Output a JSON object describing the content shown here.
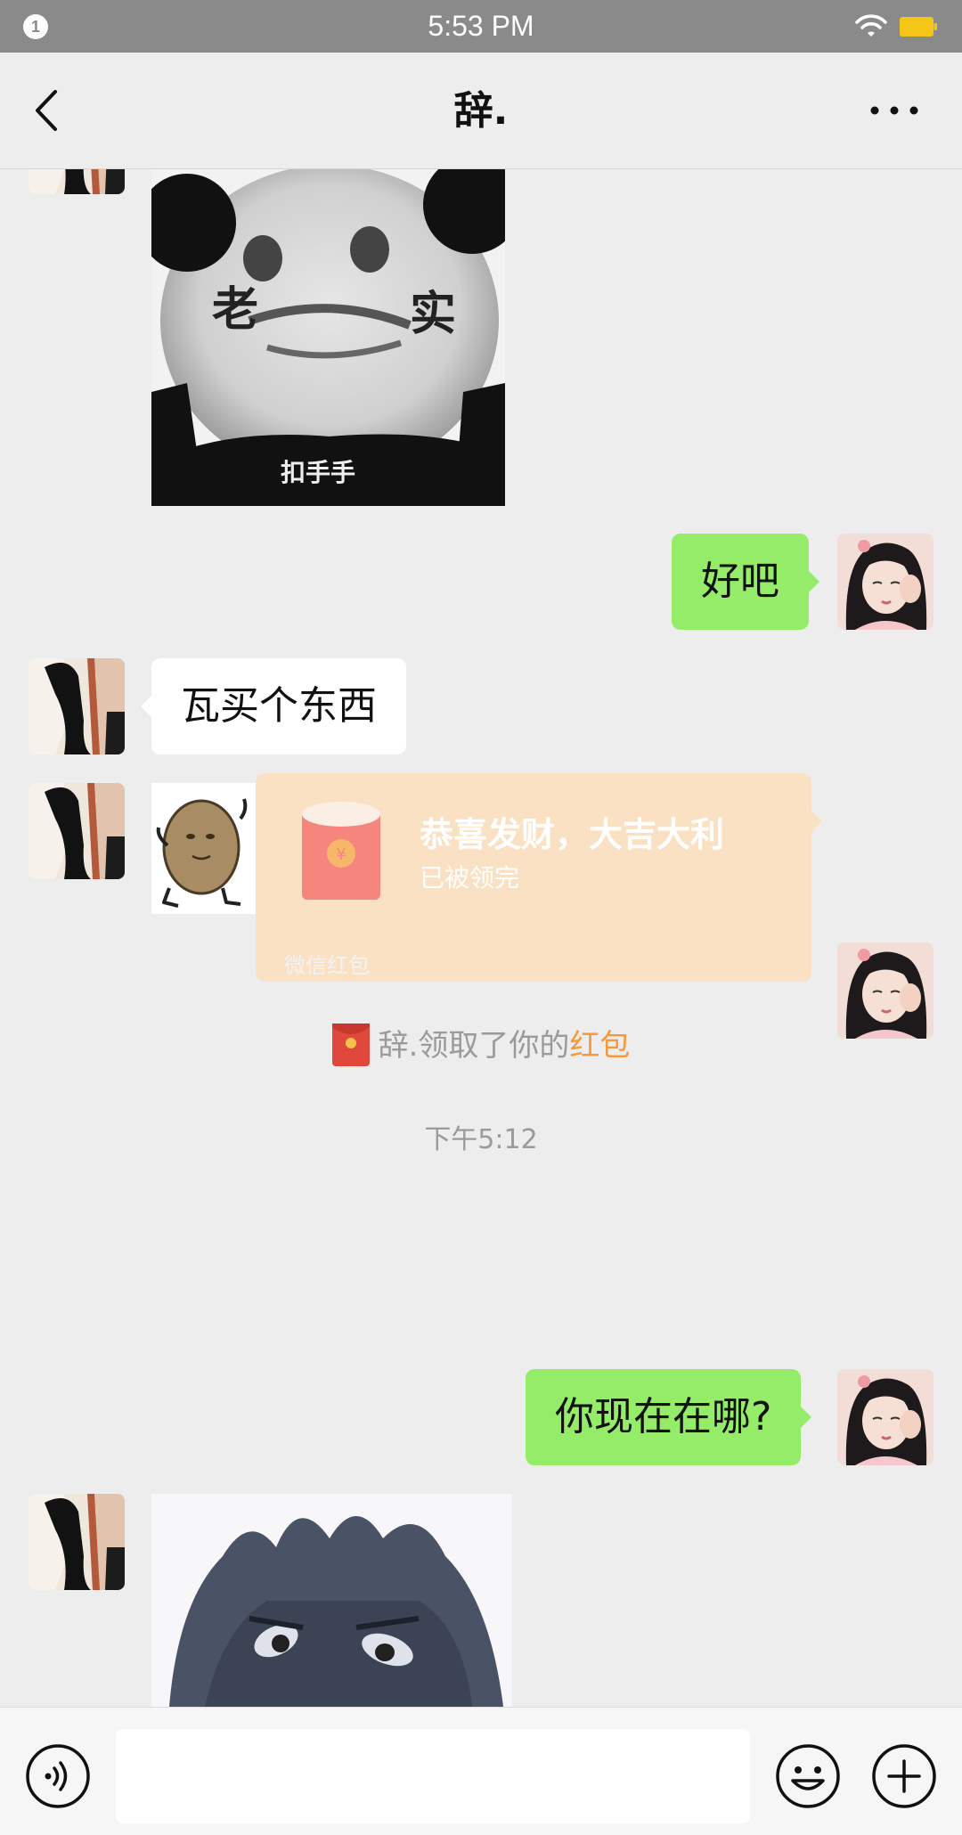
{
  "status_bar": {
    "time": "5:53 PM",
    "notification_count": "1"
  },
  "nav": {
    "title": "辞."
  },
  "messages": {
    "sticker_laoshi": {
      "left_char": "老",
      "right_char": "实",
      "caption": "扣手手"
    },
    "out_1": "好吧",
    "in_1": "瓦买个东西",
    "out_2": "你现在在哪?"
  },
  "red_packet": {
    "title": "恭喜发财，大吉大利",
    "status": "已被领完",
    "footer": "微信红包",
    "symbol": "¥"
  },
  "system_notice": {
    "text": "辞.领取了你的",
    "link": "红包"
  },
  "timestamp": "下午5:12",
  "colors": {
    "outgoing_bubble": "#95ec69",
    "incoming_bubble": "#ffffff",
    "red_packet_bg": "#fbe1c3",
    "accent_link": "#f7993a"
  }
}
